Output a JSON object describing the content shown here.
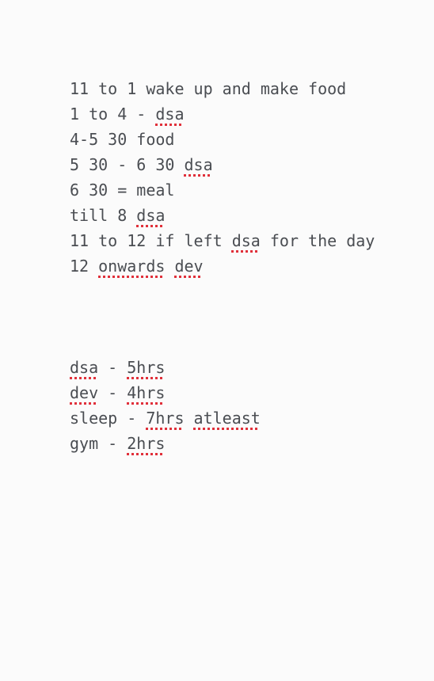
{
  "schedule": [
    {
      "segments": [
        {
          "text": "11 to 1 wake up and make food",
          "misspelled": false
        }
      ]
    },
    {
      "segments": [
        {
          "text": "1 to 4 - ",
          "misspelled": false
        },
        {
          "text": "dsa",
          "misspelled": true
        }
      ]
    },
    {
      "segments": [
        {
          "text": "4-5 30 food",
          "misspelled": false
        }
      ]
    },
    {
      "segments": [
        {
          "text": "5 30 - 6 30 ",
          "misspelled": false
        },
        {
          "text": "dsa",
          "misspelled": true
        }
      ]
    },
    {
      "segments": [
        {
          "text": "6 30 = meal",
          "misspelled": false
        }
      ]
    },
    {
      "segments": [
        {
          "text": "till 8 ",
          "misspelled": false
        },
        {
          "text": "dsa",
          "misspelled": true
        }
      ]
    },
    {
      "segments": [
        {
          "text": "11 to 12 if left ",
          "misspelled": false
        },
        {
          "text": "dsa",
          "misspelled": true
        },
        {
          "text": " for the day",
          "misspelled": false
        }
      ]
    },
    {
      "segments": [
        {
          "text": "12 ",
          "misspelled": false
        },
        {
          "text": "onwards",
          "misspelled": true
        },
        {
          "text": " ",
          "misspelled": false
        },
        {
          "text": "dev",
          "misspelled": true
        }
      ]
    }
  ],
  "totals": [
    {
      "segments": [
        {
          "text": "dsa",
          "misspelled": true
        },
        {
          "text": " - ",
          "misspelled": false
        },
        {
          "text": "5hrs",
          "misspelled": true
        }
      ]
    },
    {
      "segments": [
        {
          "text": "dev",
          "misspelled": true
        },
        {
          "text": " - ",
          "misspelled": false
        },
        {
          "text": "4hrs",
          "misspelled": true
        }
      ]
    },
    {
      "segments": [
        {
          "text": "sleep - ",
          "misspelled": false
        },
        {
          "text": "7hrs",
          "misspelled": true
        },
        {
          "text": " ",
          "misspelled": false
        },
        {
          "text": "atleast",
          "misspelled": true
        }
      ]
    },
    {
      "segments": [
        {
          "text": "gym - ",
          "misspelled": false
        },
        {
          "text": "2hrs",
          "misspelled": true
        }
      ]
    }
  ],
  "colors": {
    "background": "#fbfbfb",
    "text": "#4a4d52",
    "spellcheck_underline": "#e0303a"
  }
}
